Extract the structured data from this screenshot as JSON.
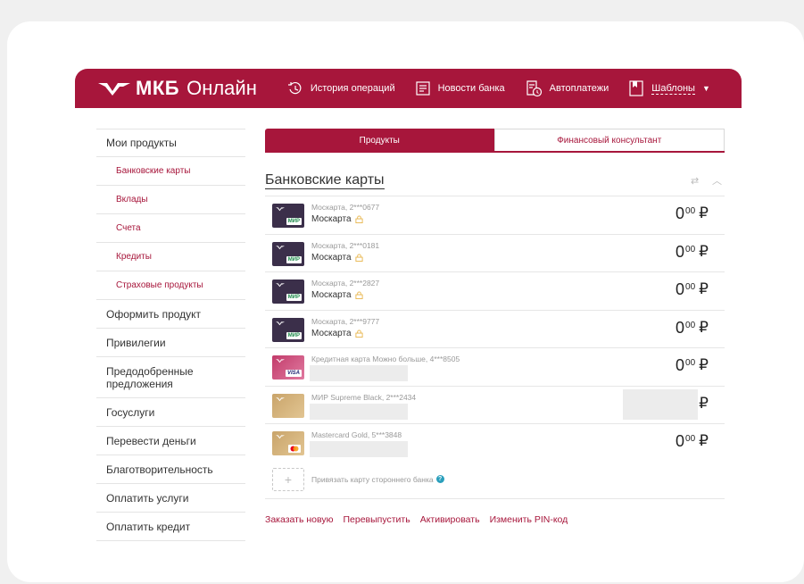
{
  "header": {
    "logo_brand": "МКБ",
    "logo_suffix": "Онлайн",
    "nav": [
      {
        "label": "История операций",
        "icon": "history-icon"
      },
      {
        "label": "Новости банка",
        "icon": "news-icon"
      },
      {
        "label": "Автоплатежи",
        "icon": "autopay-icon"
      },
      {
        "label": "Шаблоны",
        "icon": "templates-icon"
      }
    ],
    "brand_color": "#a7163b"
  },
  "sidebar": {
    "items": [
      {
        "label": "Мои продукты"
      },
      {
        "label": "Банковские карты"
      },
      {
        "label": "Вклады"
      },
      {
        "label": "Счета"
      },
      {
        "label": "Кредиты"
      },
      {
        "label": "Страховые продукты"
      },
      {
        "label": "Оформить продукт"
      },
      {
        "label": "Привилегии"
      },
      {
        "label": "Предодобренные предложения"
      },
      {
        "label": "Госуслуги"
      },
      {
        "label": "Перевести деньги"
      },
      {
        "label": "Благотворительность"
      },
      {
        "label": "Оплатить услуги"
      },
      {
        "label": "Оплатить кредит"
      }
    ]
  },
  "tabs": [
    {
      "label": "Продукты",
      "active": true
    },
    {
      "label": "Финансовый консультант",
      "active": false
    }
  ],
  "section": {
    "title": "Банковские карты"
  },
  "cards": [
    {
      "meta": "Москарта, 2***0677",
      "name": "Москарта",
      "amount_int": "0",
      "amount_kop": "00",
      "currency": "₽",
      "ps": "МИР"
    },
    {
      "meta": "Москарта, 2***0181",
      "name": "Москарта",
      "amount_int": "0",
      "amount_kop": "00",
      "currency": "₽",
      "ps": "МИР"
    },
    {
      "meta": "Москарта, 2***2827",
      "name": "Москарта",
      "amount_int": "0",
      "amount_kop": "00",
      "currency": "₽",
      "ps": "МИР"
    },
    {
      "meta": "Москарта, 2***9777",
      "name": "Москарта",
      "amount_int": "0",
      "amount_kop": "00",
      "currency": "₽",
      "ps": "МИР"
    },
    {
      "meta": "Кредитная карта Можно больше, 4***8505",
      "amount_int": "0",
      "amount_kop": "00",
      "currency": "₽",
      "ps": "VISA"
    },
    {
      "meta": "МИР Supreme Black, 2***2434",
      "currency": "₽"
    },
    {
      "meta": "Mastercard Gold, 5***3848",
      "amount_int": "0",
      "amount_kop": "00",
      "currency": "₽"
    }
  ],
  "attach": {
    "label": "Привязать карту стороннего банка",
    "help": "?"
  },
  "actions": [
    "Заказать новую",
    "Перевыпустить",
    "Активировать",
    "Изменить PIN-код"
  ]
}
